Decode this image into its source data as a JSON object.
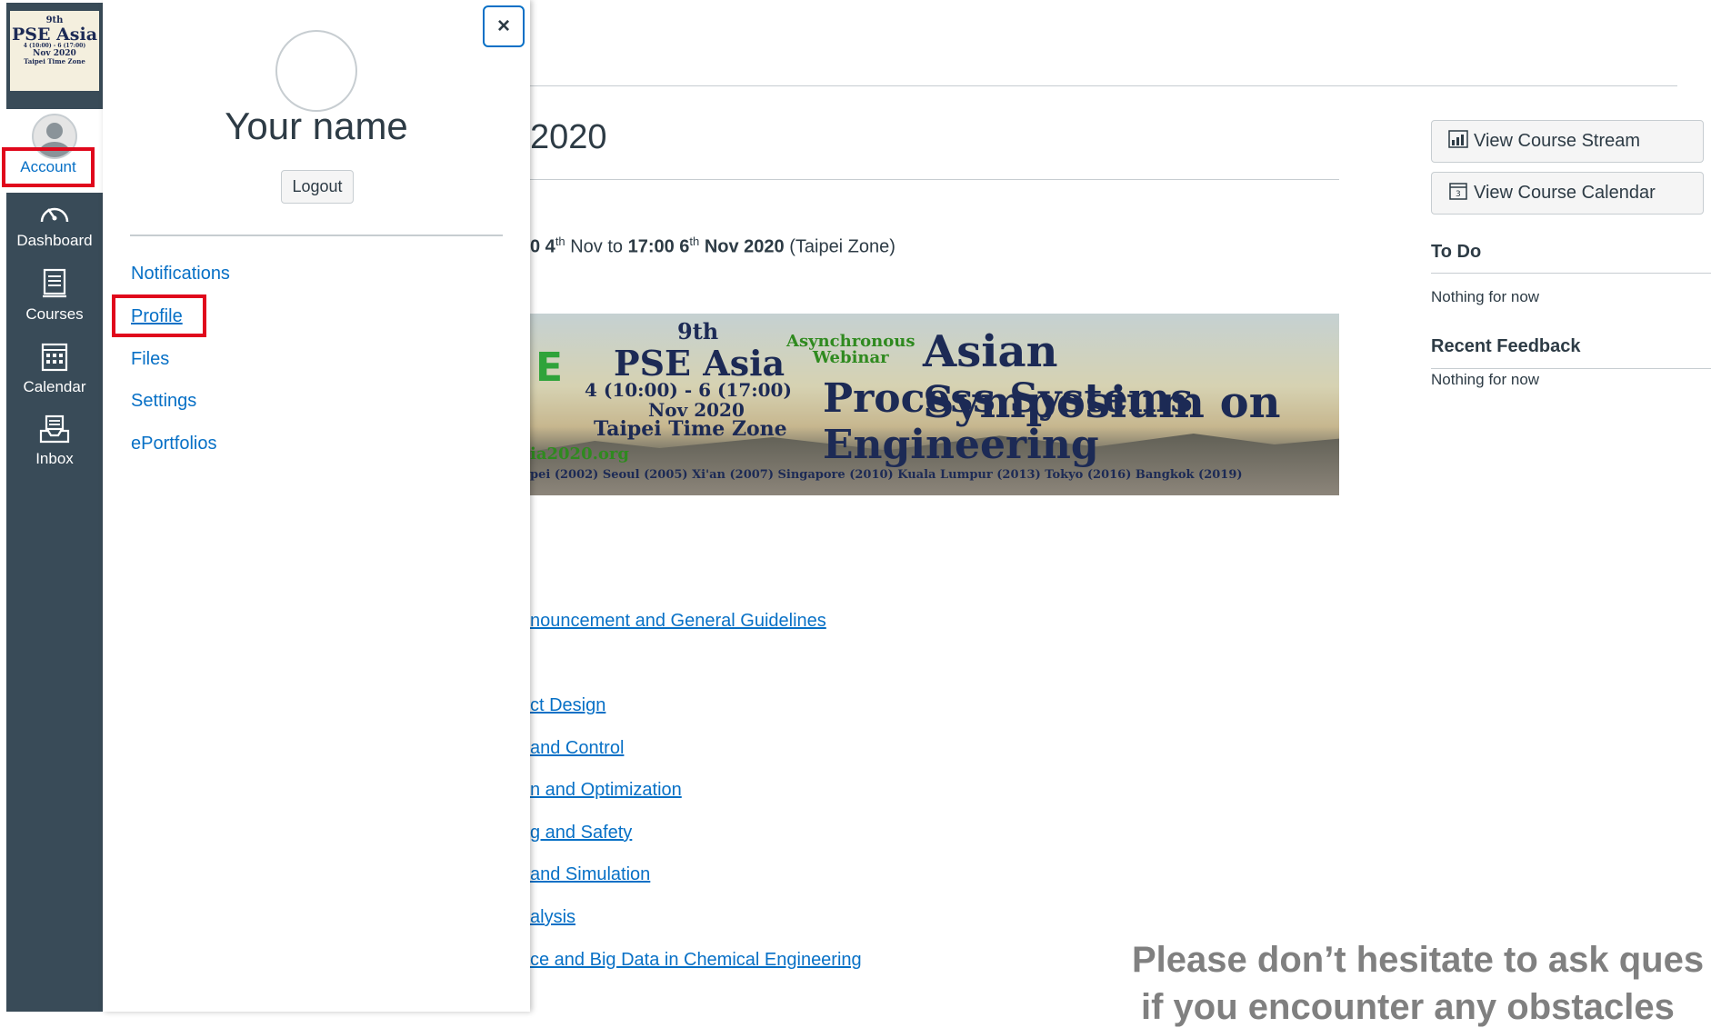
{
  "global_nav": {
    "logo": {
      "line1": "9th",
      "line2": "PSE Asia",
      "line3": "4 (10:00) - 6 (17:00)",
      "line4": "Nov 2020",
      "line5": "Taipei Time Zone"
    },
    "items": [
      {
        "label": "Account",
        "icon": "user-avatar-icon",
        "active": true
      },
      {
        "label": "Dashboard",
        "icon": "dashboard-icon"
      },
      {
        "label": "Courses",
        "icon": "courses-icon"
      },
      {
        "label": "Calendar",
        "icon": "calendar-icon"
      },
      {
        "label": "Inbox",
        "icon": "inbox-icon"
      }
    ]
  },
  "account_tray": {
    "close_label": "×",
    "user_name": "Your name",
    "logout_label": "Logout",
    "links": [
      {
        "label": "Notifications"
      },
      {
        "label": "Profile",
        "highlighted": true
      },
      {
        "label": "Files"
      },
      {
        "label": "Settings"
      },
      {
        "label": "ePortfolios"
      }
    ]
  },
  "course": {
    "title_visible": "2020",
    "date_line": {
      "prefix": "0 4",
      "sup1": "th",
      "mid1": " Nov to ",
      "bold2": "17:00 6",
      "sup2": "th",
      "mid2": " Nov 2020",
      "suffix": " (Taipei Zone)"
    },
    "banner": {
      "letter": "E",
      "nth": "9th",
      "pse": "PSE Asia",
      "time": "4 (10:00) - 6 (17:00)",
      "nov": "Nov 2020",
      "zone": "Taipei Time Zone",
      "webinar_1": "Asynchronous",
      "webinar_2": "Webinar",
      "asian": "Asian Symposium on",
      "process": "Process Systems Engineering",
      "org": "ia2020.org",
      "cities": "pei (2002)  Seoul (2005)  Xi'an (2007)  Singapore (2010)  Kuala Lumpur (2013)  Tokyo (2016)  Bangkok (2019)"
    },
    "links": [
      "nouncement and General Guidelines",
      "ct Design",
      "and Control",
      "n and Optimization",
      "g and Safety",
      "and Simulation",
      "alysis",
      "ce and Big Data in Chemical Engineering"
    ]
  },
  "aside": {
    "buttons": [
      {
        "label": "View Course Stream",
        "icon": "stream-chart-icon"
      },
      {
        "label": "View Course Calendar",
        "icon": "calendar-icon"
      }
    ],
    "todo_heading": "To Do",
    "todo_empty": "Nothing for now",
    "feedback_heading": "Recent Feedback",
    "feedback_empty": "Nothing for now"
  },
  "overlay_note": {
    "line1": "Please don’t hesitate to ask ques",
    "line2": "if you encounter any obstacles"
  },
  "colors": {
    "nav_bg": "#394b58",
    "link": "#0770c6",
    "highlight": "#e0081c"
  }
}
